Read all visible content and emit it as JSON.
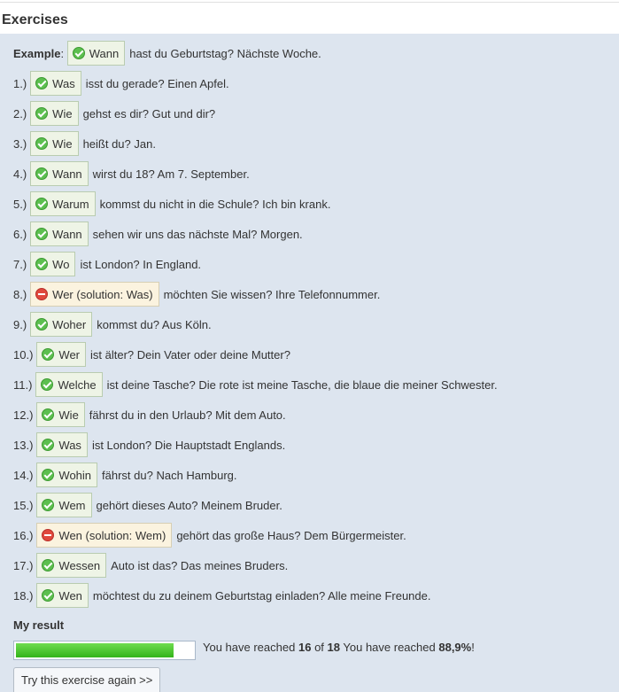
{
  "title": "Exercises",
  "example": {
    "label": "Example",
    "colon": ":",
    "answer": "Wann",
    "text": "hast du Geburtstag? Nächste Woche."
  },
  "items": [
    {
      "num": "1.)",
      "answer": "Was",
      "status": "correct",
      "text": "isst du gerade? Einen Apfel."
    },
    {
      "num": "2.)",
      "answer": "Wie",
      "status": "correct",
      "text": "gehst es dir? Gut und dir?"
    },
    {
      "num": "3.)",
      "answer": "Wie",
      "status": "correct",
      "text": "heißt du? Jan."
    },
    {
      "num": "4.)",
      "answer": "Wann",
      "status": "correct",
      "text": "wirst du 18? Am 7. September."
    },
    {
      "num": "5.)",
      "answer": "Warum",
      "status": "correct",
      "text": "kommst du nicht in die Schule? Ich bin krank."
    },
    {
      "num": "6.)",
      "answer": "Wann",
      "status": "correct",
      "text": "sehen wir uns das nächste Mal? Morgen."
    },
    {
      "num": "7.)",
      "answer": "Wo",
      "status": "correct",
      "text": "ist London? In England."
    },
    {
      "num": "8.)",
      "answer": "Wer (solution: Was)",
      "status": "wrong",
      "text": "möchten Sie wissen? Ihre Telefonnummer."
    },
    {
      "num": "9.)",
      "answer": "Woher",
      "status": "correct",
      "text": "kommst du? Aus Köln."
    },
    {
      "num": "10.)",
      "answer": "Wer",
      "status": "correct",
      "text": "ist älter? Dein Vater oder deine Mutter?"
    },
    {
      "num": "11.)",
      "answer": "Welche",
      "status": "correct",
      "text": "ist deine Tasche? Die rote ist meine Tasche, die blaue die meiner Schwester."
    },
    {
      "num": "12.)",
      "answer": "Wie",
      "status": "correct",
      "text": "fährst du in den Urlaub? Mit dem Auto."
    },
    {
      "num": "13.)",
      "answer": "Was",
      "status": "correct",
      "text": "ist London? Die Hauptstadt Englands."
    },
    {
      "num": "14.)",
      "answer": "Wohin",
      "status": "correct",
      "text": "fährst du? Nach Hamburg."
    },
    {
      "num": "15.)",
      "answer": "Wem",
      "status": "correct",
      "text": "gehört dieses Auto? Meinem Bruder."
    },
    {
      "num": "16.)",
      "answer": "Wen (solution: Wem)",
      "status": "wrong",
      "text": "gehört das große Haus? Dem Bürgermeister."
    },
    {
      "num": "17.)",
      "answer": "Wessen",
      "status": "correct",
      "text": "Auto ist das? Das meines Bruders."
    },
    {
      "num": "18.)",
      "answer": "Wen",
      "status": "correct",
      "text": "möchtest du zu deinem Geburtstag einladen? Alle meine Freunde."
    }
  ],
  "result": {
    "title": "My result",
    "progress_fraction": 0.889,
    "prefix": "You have reached",
    "score": "16",
    "of": "of",
    "total": "18",
    "suffix": "You have reached",
    "percent": "88,9%",
    "end": "!"
  },
  "retry_label": "Try this exercise again >>",
  "icons": {
    "correct": "check-circle-icon",
    "wrong": "minus-circle-icon"
  },
  "colors": {
    "panel": "#dde5ef",
    "correct_bg": "#eef4e6",
    "wrong_bg": "#fbf3df",
    "progress": "#33b41a"
  }
}
